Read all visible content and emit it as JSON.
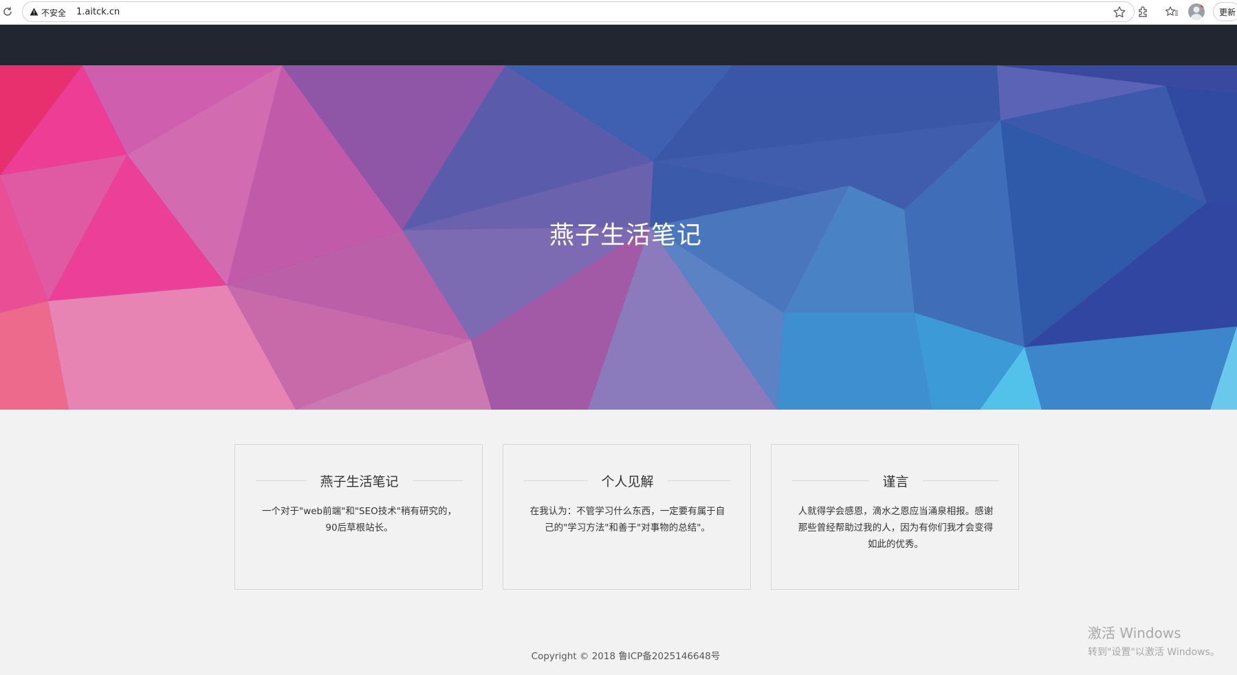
{
  "browser": {
    "security_label": "不安全",
    "url": "1.aitck.cn",
    "update_label": "更新"
  },
  "hero": {
    "title": "燕子生活笔记"
  },
  "cards": [
    {
      "title": "燕子生活笔记",
      "text": "一个对于\"web前端\"和\"SEO技术\"稍有研究的，90后草根站长。"
    },
    {
      "title": "个人见解",
      "text": "在我认为：不管学习什么东西，一定要有属于自己的\"学习方法\"和善于\"对事物的总结\"。"
    },
    {
      "title": "谨言",
      "text": "人就得学会感恩，滴水之恩应当涌泉相报。感谢那些曾经帮助过我的人，因为有你们我才会变得如此的优秀。"
    }
  ],
  "footer": {
    "copyright": "Copyright © 2018  鲁ICP备2025146648号"
  },
  "watermark": {
    "line1": "激活 Windows",
    "line2": "转到\"设置\"以激活 Windows。"
  }
}
